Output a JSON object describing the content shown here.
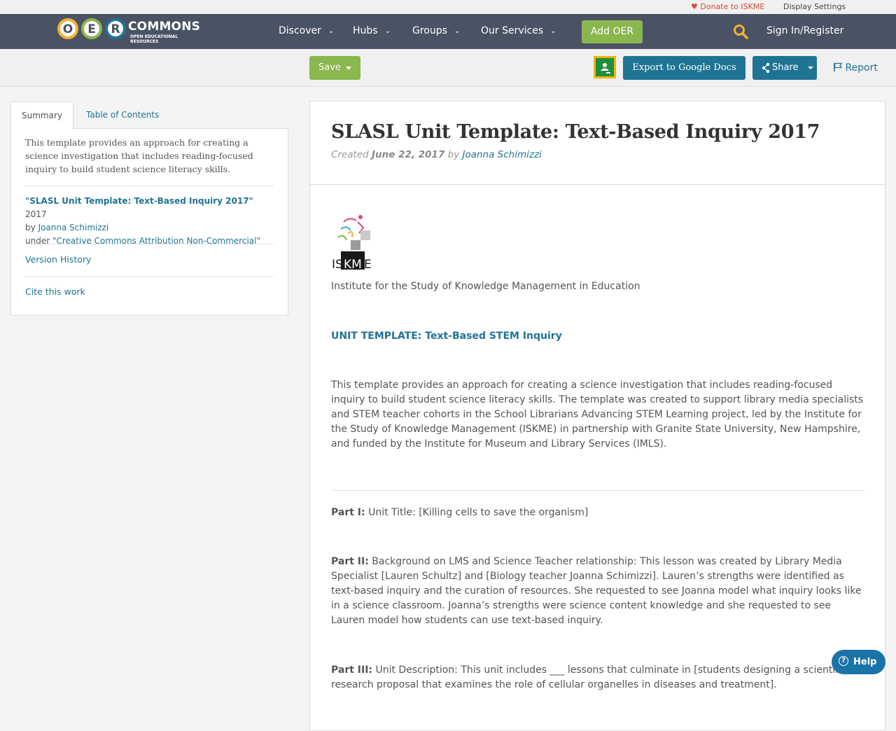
{
  "util": {
    "donate": "Donate to ISKME",
    "display_settings": "Display Settings"
  },
  "nav": {
    "logo_letters": [
      "O",
      "E",
      "R"
    ],
    "logo_word": "COMMONS",
    "logo_sub": "OPEN EDUCATIONAL RESOURCES",
    "items": [
      "Discover",
      "Hubs",
      "Groups",
      "Our Services"
    ],
    "add_oer": "Add OER",
    "sign_in": "Sign In/Register",
    "colors": {
      "bar": "#4a5364",
      "accent_green": "#8ab74e",
      "logo_o": "#f2b134",
      "logo_e": "#8ab74e",
      "logo_r": "#1f7493"
    }
  },
  "toolbar": {
    "save": "Save",
    "export": "Export to Google Docs",
    "share": "Share",
    "report": "Report"
  },
  "sidebar": {
    "tabs": [
      "Summary",
      "Table of Contents"
    ],
    "description": "This template provides an approach for creating a science investigation that includes reading-focused inquiry to build student science literacy skills.",
    "attribution": {
      "title": "\"SLASL Unit Template: Text-Based Inquiry 2017\"",
      "year": "2017",
      "by": "by",
      "author": "Joanna Schimizzi",
      "under": "under",
      "license": "\"Creative Commons Attribution Non-Commercial\""
    },
    "links": [
      "Version History",
      "Cite this work"
    ]
  },
  "main": {
    "title": "SLASL Unit Template: Text-Based Inquiry 2017",
    "created_label": "Created",
    "created_date": "June 22, 2017",
    "by_label": "by",
    "author": "Joanna Schimizzi",
    "logo_text": "ISKME",
    "institute": "Institute for the Study of Knowledge Management in Education",
    "unit_heading": "UNIT TEMPLATE: Text-Based STEM Inquiry",
    "intro": "This template provides an approach for creating a science investigation that includes reading-focused inquiry to build student science literacy skills. The template was created to support library media specialists and STEM teacher cohorts in the School Librarians Advancing STEM Learning project, led by the Institute for the Study of Knowledge Management (ISKME) in partnership with Granite State University, New Hampshire, and funded by the Institute for Museum and Library Services (IMLS).",
    "part1_label": "Part I:",
    "part1_text": " Unit Title: [Killing cells to save the organism]",
    "part2_label": "Part II:",
    "part2_text": " Background on LMS and Science Teacher relationship: This lesson was created by Library Media Specialist [Lauren Schultz]  and [Biology teacher Joanna Schimizzi]. Lauren’s strengths were identified as text-based inquiry and the curation of resources.  She requested to see Joanna model what inquiry looks like in a science classroom.  Joanna’s strengths were science content knowledge and she requested to see Lauren model how students can use text-based inquiry.",
    "part3_label": "Part III:",
    "part3_text": " Unit Description: This unit includes ___ lessons that culminate in [students designing a scientific research proposal that examines the role of cellular organelles in diseases and treatment]."
  },
  "help": "Help"
}
